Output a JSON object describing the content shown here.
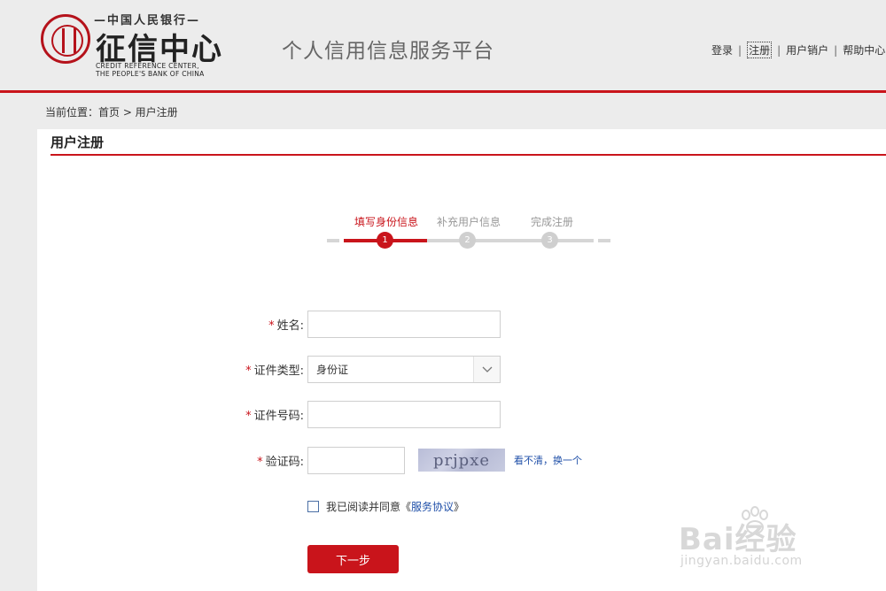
{
  "header": {
    "logo_top_text": "—中国人民银行—",
    "logo_main_text": "征信中心",
    "logo_en_line1": "CREDIT REFERENCE  CENTER,",
    "logo_en_line2": "THE PEOPLE'S BANK OF CHINA",
    "platform_title": "个人信用信息服务平台",
    "nav": {
      "login": "登录",
      "register": "注册",
      "deregister": "用户销户",
      "help": "帮助中心",
      "separator": "|"
    },
    "accent_color": "#c9141b"
  },
  "breadcrumb": "当前位置：首页 > 用户注册",
  "section_title": "用户注册",
  "steps": [
    {
      "label": "填写身份信息",
      "number": "1",
      "state": "active"
    },
    {
      "label": "补充用户信息",
      "number": "2",
      "state": "inactive"
    },
    {
      "label": "完成注册",
      "number": "3",
      "state": "inactive"
    }
  ],
  "form": {
    "required_mark": "*",
    "name_label": "姓名:",
    "name_value": "",
    "id_type_label": "证件类型:",
    "id_type_value": "身份证",
    "id_number_label": "证件号码:",
    "id_number_value": "",
    "captcha_label": "验证码:",
    "captcha_value": "",
    "captcha_image_text": "prjpxe",
    "captcha_refresh": "看不清，换一个",
    "agree_text": "我已阅读并同意《",
    "agree_link": "服务协议",
    "agree_close": "》",
    "agree_checked": false,
    "next_button": "下一步"
  },
  "watermark": {
    "main": "Bai经验",
    "sub": "jingyan.baidu.com"
  }
}
